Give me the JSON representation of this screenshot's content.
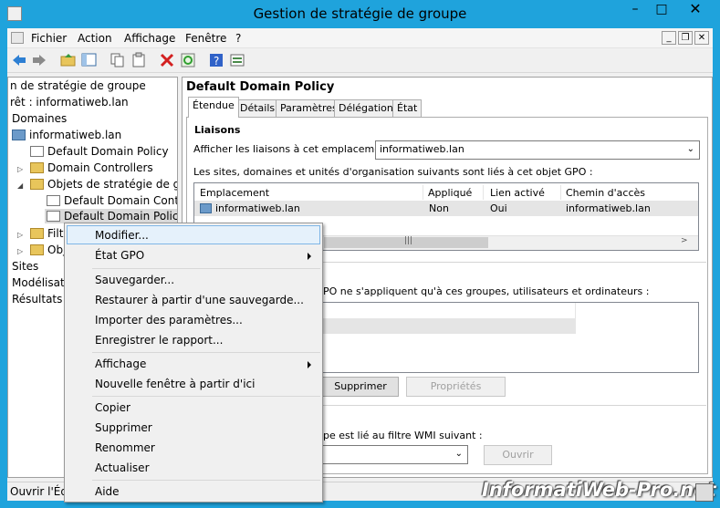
{
  "window": {
    "title": "Gestion de stratégie de groupe"
  },
  "menu": {
    "fichier": "Fichier",
    "action": "Action",
    "affichage": "Affichage",
    "fenetre": "Fenêtre",
    "help": "?"
  },
  "tree": {
    "root": "n de stratégie de groupe",
    "forest": "rêt : informatiweb.lan",
    "domains": "Domaines",
    "domain": "informatiweb.lan",
    "ddp": "Default Domain Policy",
    "dc": "Domain Controllers",
    "gpo_objects": "Objets de stratégie de grou",
    "ddcp": "Default Domain Contro",
    "ddp_selected": "Default Domain Policy",
    "filters": "Filtr",
    "starter": "Obj",
    "sites": "Sites",
    "modeling": "Modélisati",
    "results": "Résultats d"
  },
  "panel": {
    "title": "Default Domain Policy",
    "tabs": [
      "Étendue",
      "Détails",
      "Paramètres",
      "Délégation",
      "État"
    ],
    "links_heading": "Liaisons",
    "links_label": "Afficher les liaisons à cet emplacement :",
    "links_combo": "informatiweb.lan",
    "links_desc": "Les sites, domaines et unités d'organisation suivants sont liés à cet objet GPO :",
    "links_columns": [
      "Emplacement",
      "Appliqué",
      "Lien activé",
      "Chemin d'accès"
    ],
    "links_rows": [
      {
        "location": "informatiweb.lan",
        "enforced": "Non",
        "enabled": "Oui",
        "path": "informatiweb.lan"
      }
    ],
    "filter_desc": "PO ne s'appliquent qu'à ces groupes, utilisateurs et ordinateurs :",
    "remove_btn": "Supprimer",
    "props_btn": "Propriétés",
    "wmi_desc": "pe est lié au filtre WMI suivant :",
    "open_btn": "Ouvrir"
  },
  "context_menu": {
    "items": [
      "Modifier...",
      "État GPO",
      "Sauvegarder...",
      "Restaurer à partir d'une sauvegarde...",
      "Importer des paramètres...",
      "Enregistrer le rapport...",
      "Affichage",
      "Nouvelle fenêtre à partir d'ici",
      "Copier",
      "Supprimer",
      "Renommer",
      "Actualiser",
      "Aide"
    ]
  },
  "status": {
    "text": "Ouvrir l'Édi"
  },
  "watermark": "InformatiWeb-Pro.net",
  "colors": {
    "titlebar": "#1fa3dc",
    "highlight": "#e5f1fb"
  }
}
